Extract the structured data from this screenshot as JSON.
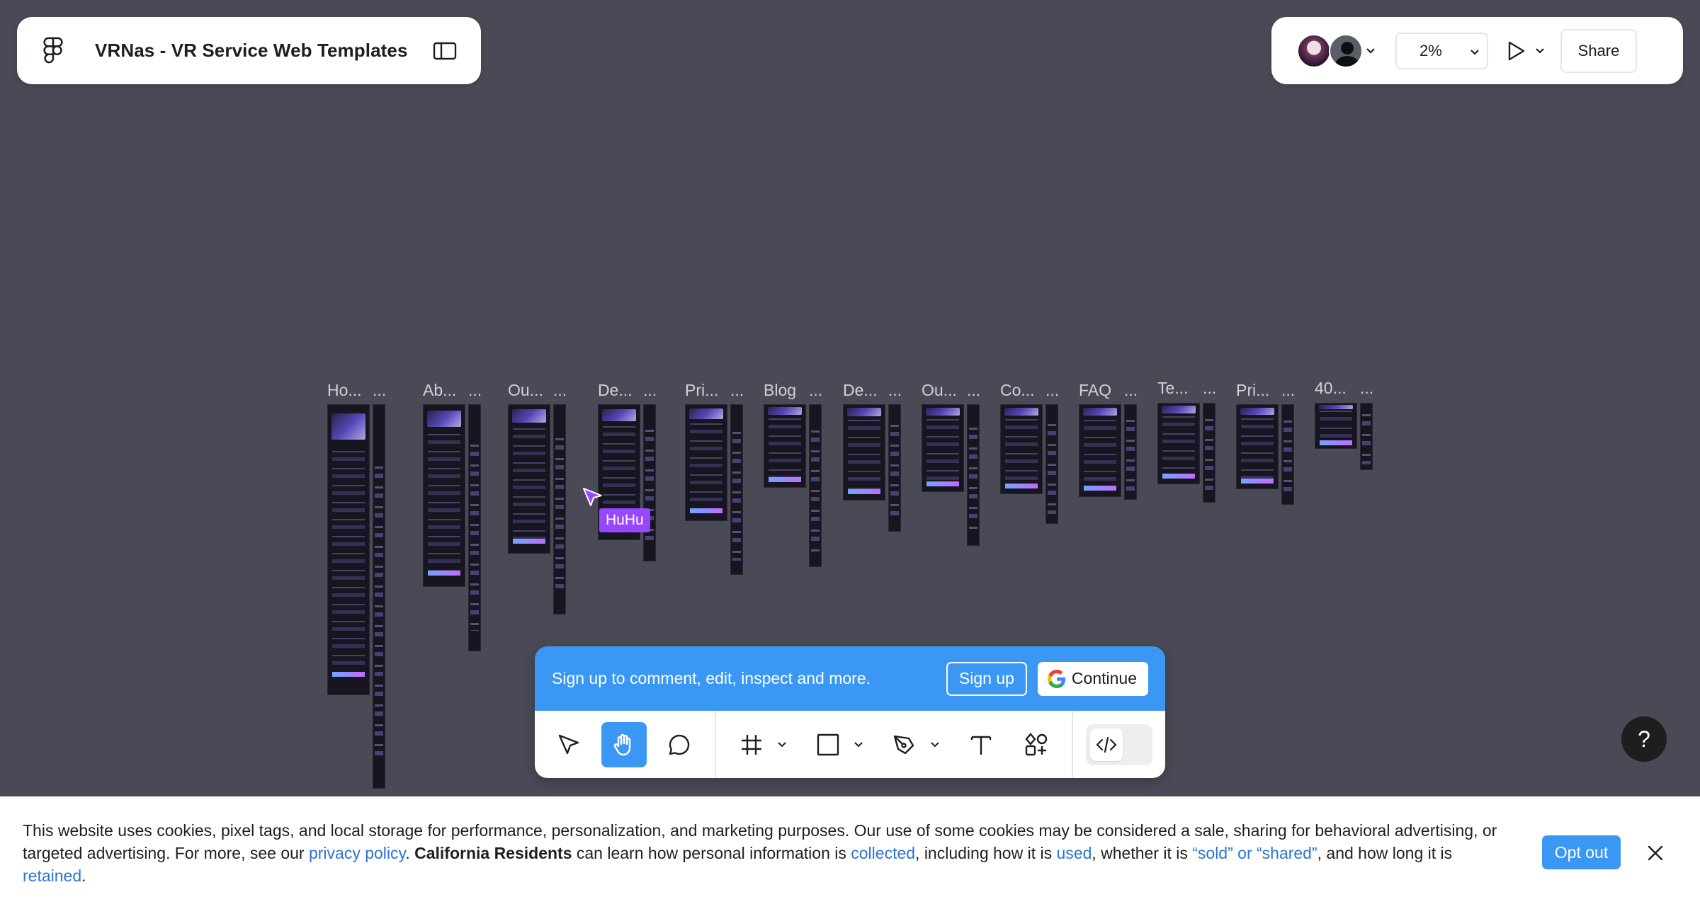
{
  "file": {
    "title": "VRNas - VR Service Web Templates"
  },
  "header": {
    "zoom": "2%",
    "share_label": "Share"
  },
  "frames": [
    {
      "label": "Ho..."
    },
    {
      "label": "..."
    },
    {
      "label": "Ab..."
    },
    {
      "label": "..."
    },
    {
      "label": "Ou..."
    },
    {
      "label": "..."
    },
    {
      "label": "De..."
    },
    {
      "label": "..."
    },
    {
      "label": "Pri..."
    },
    {
      "label": "..."
    },
    {
      "label": "Blog"
    },
    {
      "label": "..."
    },
    {
      "label": "De..."
    },
    {
      "label": "..."
    },
    {
      "label": "Ou..."
    },
    {
      "label": "..."
    },
    {
      "label": "Co..."
    },
    {
      "label": "..."
    },
    {
      "label": "FAQ"
    },
    {
      "label": "..."
    },
    {
      "label": "Te..."
    },
    {
      "label": "..."
    },
    {
      "label": "Pri..."
    },
    {
      "label": "..."
    },
    {
      "label": "40..."
    },
    {
      "label": "..."
    }
  ],
  "cursor": {
    "name": "HuHu",
    "color": "#9747ff"
  },
  "signup": {
    "text": "Sign up to comment, edit, inspect and more.",
    "signup_label": "Sign up",
    "continue_label": "Continue"
  },
  "tools": [
    "move-icon",
    "hand-icon",
    "comment-icon",
    "frame-icon",
    "rectangle-icon",
    "pen-icon",
    "text-icon",
    "resources-icon",
    "dev-mode-icon"
  ],
  "help": {
    "label": "?"
  },
  "cookie": {
    "text_1": "This website uses cookies, pixel tags, and local storage for performance, personalization, and marketing purposes. Our use of some cookies may be considered a sale, sharing for behavioral advertising, or targeted advertising. For more, see our ",
    "link_privacy": "privacy policy",
    "text_2": ". ",
    "bold_ca": "California Residents",
    "text_3": " can learn how personal information is ",
    "link_collected": "collected",
    "text_4": ", including how it is ",
    "link_used": "used",
    "text_5": ", whether it is ",
    "link_sold": "“sold” or “shared”",
    "text_6": ", and how long it is ",
    "link_retained": "retained",
    "text_7": ".",
    "optout_label": "Opt out"
  },
  "colors": {
    "canvas": "#4a4a56",
    "accent": "#3a97f3",
    "link": "#2a74d5",
    "cursor": "#9747ff"
  }
}
